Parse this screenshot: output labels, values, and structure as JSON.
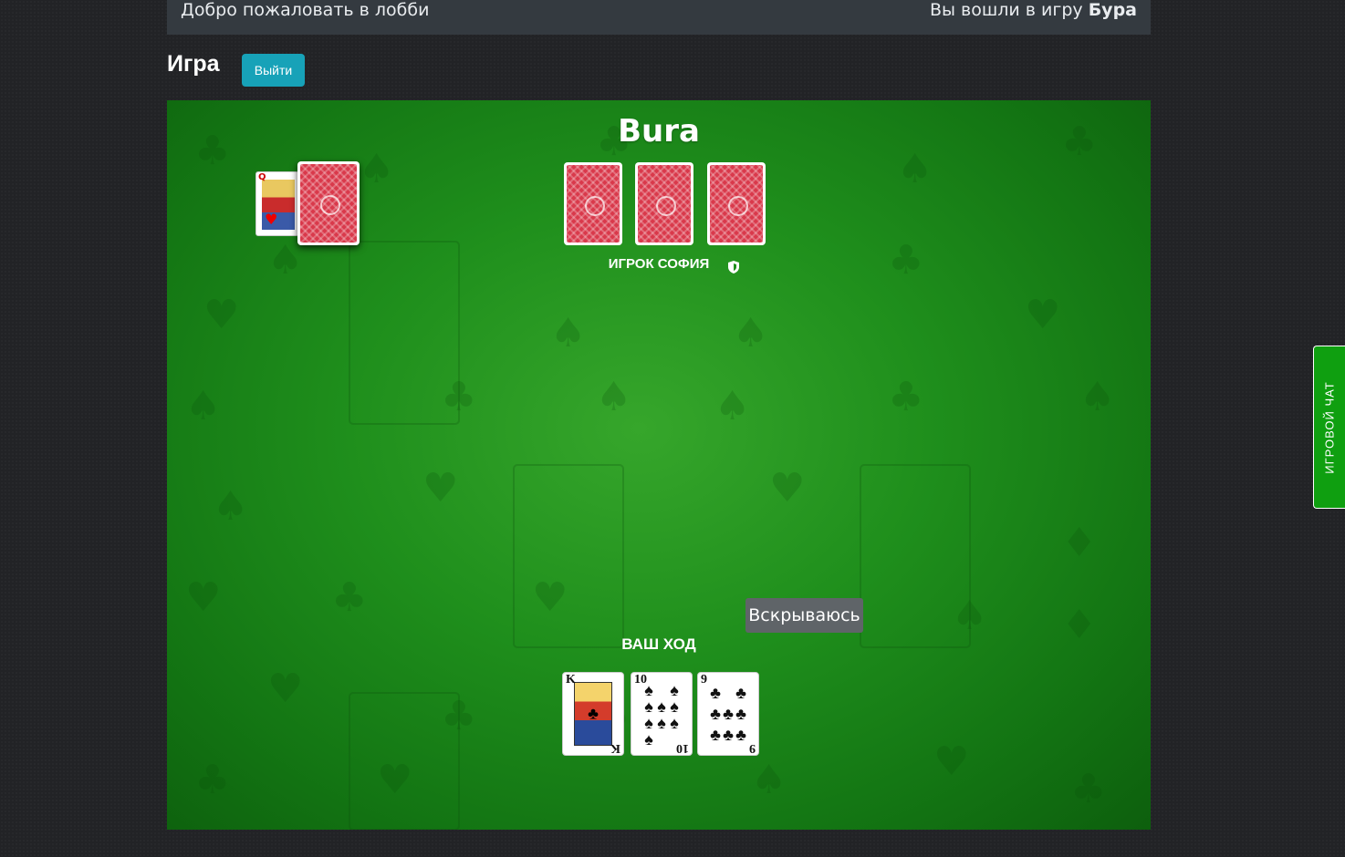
{
  "topbar": {
    "welcome": "Добро пожаловать в лобби",
    "joined_prefix": "Вы вошли в игру ",
    "game_name": "Бура"
  },
  "page": {
    "heading": "Игра",
    "exit_label": "Выйти"
  },
  "table": {
    "title": "Bura",
    "opponent_label": "ИГРОК СОФИЯ",
    "opponent_card_count": 3,
    "turn_label": "ВАШ ХОД",
    "reveal_label": "Вскрываюсь",
    "trump_card": {
      "rank": "Q",
      "suit": "♥"
    },
    "hand": [
      {
        "rank": "K",
        "suit": "♣",
        "face": "king"
      },
      {
        "rank": "10",
        "suit": "♠"
      },
      {
        "rank": "9",
        "suit": "♣"
      }
    ]
  },
  "chat": {
    "tab_label": "ИГРОВОЙ ЧАТ"
  },
  "colors": {
    "felt": "#1f8f1c",
    "exit_button": "#17a2b8",
    "chat_tab": "#0f9f10",
    "card_back": "#d9394b"
  }
}
